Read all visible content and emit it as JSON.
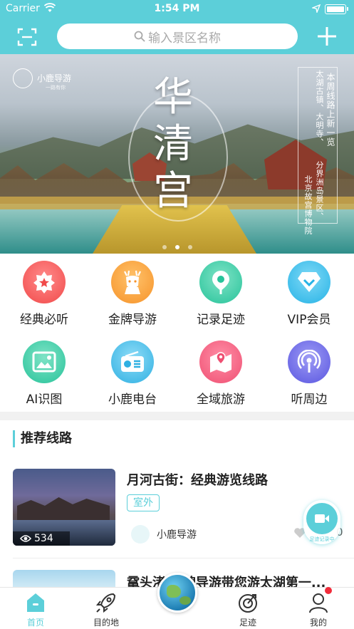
{
  "status_bar": {
    "carrier": "Carrier",
    "time": "1:54 PM"
  },
  "header": {
    "search_placeholder": "输入景区名称"
  },
  "banner": {
    "logo_text": "小鹿导游",
    "logo_sub": "一路有你",
    "calligraphy": [
      "华",
      "清",
      "宫"
    ],
    "side_texts": [
      "本周线路上新一览",
      "太湖古镇、大明寺、",
      "分界洲岛景区、",
      "北京故宫博物院"
    ],
    "page_count": 3,
    "active_page": 2
  },
  "features": [
    {
      "label": "经典必听",
      "icon": "star-badge-icon",
      "color": "#f45a5a"
    },
    {
      "label": "金牌导游",
      "icon": "deer-icon",
      "color": "#f7a23a"
    },
    {
      "label": "记录足迹",
      "icon": "location-pin-icon",
      "color": "#3fcfa8"
    },
    {
      "label": "VIP会员",
      "icon": "diamond-icon",
      "color": "#38c0ea"
    },
    {
      "label": "AI识图",
      "icon": "image-scan-icon",
      "color": "#3fcfa8"
    },
    {
      "label": "小鹿电台",
      "icon": "radio-icon",
      "color": "#3fb7e6"
    },
    {
      "label": "全域旅游",
      "icon": "map-icon",
      "color": "#f25b7a"
    },
    {
      "label": "听周边",
      "icon": "broadcast-icon",
      "color": "#6a67e8"
    }
  ],
  "section": {
    "title": "推荐线路"
  },
  "routes": [
    {
      "title": "月河古街：经典游览线路",
      "tag": "室外",
      "views": "534",
      "author": "小鹿导游",
      "likes": "0"
    },
    {
      "title": "鼋头渚·金牌导游带您游太湖第一..."
    }
  ],
  "floating": {
    "label": "足迹记录中"
  },
  "tabs": [
    {
      "label": "首页",
      "icon": "home-icon",
      "active": true
    },
    {
      "label": "目的地",
      "icon": "rocket-icon",
      "active": false
    },
    {
      "label": "",
      "icon": "globe-icon",
      "active": false
    },
    {
      "label": "足迹",
      "icon": "target-icon",
      "active": false
    },
    {
      "label": "我的",
      "icon": "user-icon",
      "active": false
    }
  ],
  "colors": {
    "accent": "#5ccfd9",
    "badge": "#f12b3a"
  }
}
